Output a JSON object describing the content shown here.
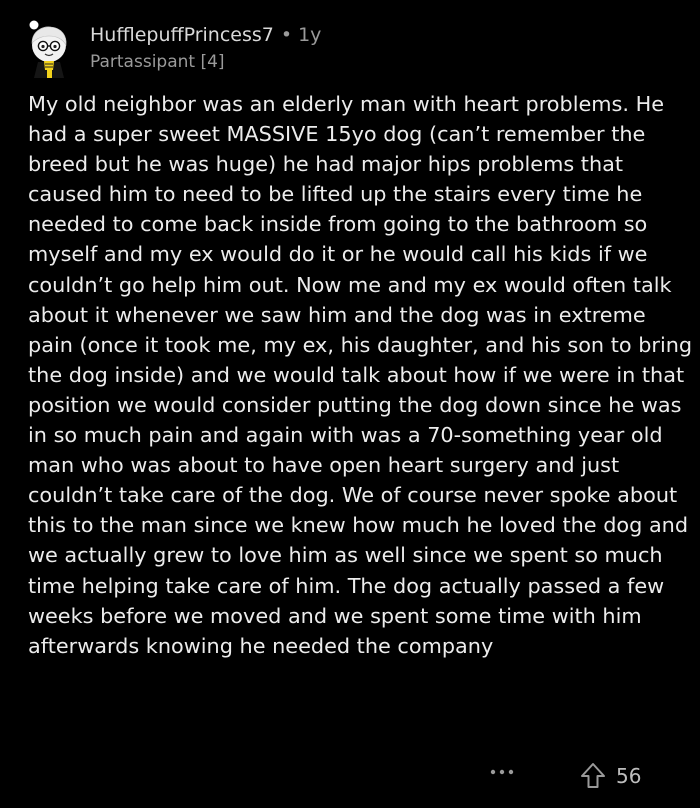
{
  "comment": {
    "username": "HufflepuffPrincess7",
    "separator": "•",
    "age": "1y",
    "flair": "Partassipant [4]",
    "body": "My old neighbor was an elderly man with heart problems. He had a super sweet MASSIVE 15yo dog (can’t remember the breed but he was huge) he had major hips problems that caused him to need to be lifted up the stairs every time he needed to come back inside from going to the bathroom so myself and my ex would do it or he would call his kids if we couldn’t go help him out. Now me and my ex would often talk about it whenever we saw him and the dog was in extreme pain (once it took me, my ex, his daughter, and his son to bring the dog inside) and we would talk about how if we were in that position we would consider putting the dog down since he was in so much pain and again with was a 70-something year old man who was about to have open heart surgery and just couldn’t take care of the dog. We of course never spoke about this to the man since we knew how much he loved the dog and we actually grew to love him as well since we spent so much time helping take care of him. The dog actually passed a few weeks before we moved and we spent some time with him afterwards knowing he needed the company",
    "score": "56"
  },
  "icons": {
    "avatar": "avatar-hufflepuff-character",
    "more": "more-options-icon",
    "upvote": "upvote-arrow-icon"
  },
  "colors": {
    "background": "#000000",
    "text": "#ececec",
    "muted": "#9a9a9a",
    "avatar_accent": "#f2d21b"
  }
}
